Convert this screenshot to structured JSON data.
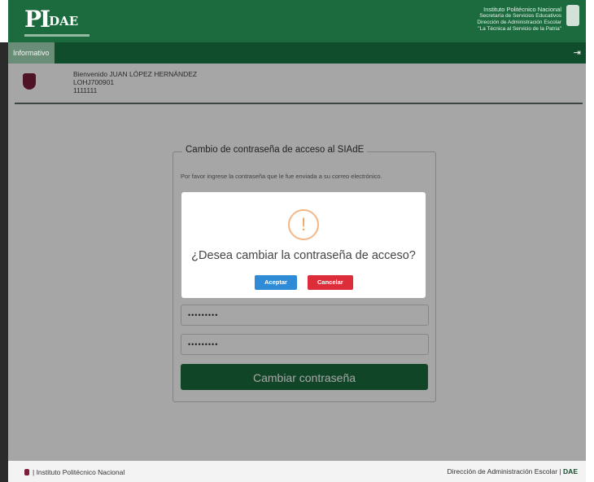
{
  "header": {
    "logo_main": "PI",
    "logo_sub": "DAE",
    "institution": "Instituto Politécnico Nacional",
    "secretaria": "Secretaría de Servicios Educativos",
    "direccion": "Dirección de Administración Escolar",
    "lema": "\"La Técnica al Servicio de la Patria\""
  },
  "nav": {
    "tab_label": "Informativo",
    "logout_glyph": "⇥"
  },
  "user": {
    "welcome": "Bienvenido JUAN LÓPEZ HERNÁNDEZ",
    "curp": "LOHJ700901",
    "number": "1111111"
  },
  "form": {
    "legend": "Cambio de contraseña de acceso al SIAdE",
    "hint": "Por favor ingrese la contraseña que le fue enviada a su correo electrónico.",
    "pwd1": "•••••••••",
    "pwd2": "•••••••••",
    "submit_label": "Cambiar contraseña"
  },
  "dialog": {
    "icon_glyph": "!",
    "title": "¿Desea cambiar la contraseña de acceso?",
    "accept_label": "Aceptar",
    "cancel_label": "Cancelar"
  },
  "footer": {
    "left": "| Instituto Politécnico Nacional",
    "right": "Dirección de Administración Escolar |",
    "right_brand": "DAE"
  },
  "colors": {
    "primary_green": "#1b6b3e",
    "dark_green": "#0f4d2c",
    "accept_blue": "#2f8bd6",
    "cancel_red": "#de2d3a",
    "warning_orange": "#f3b787"
  }
}
